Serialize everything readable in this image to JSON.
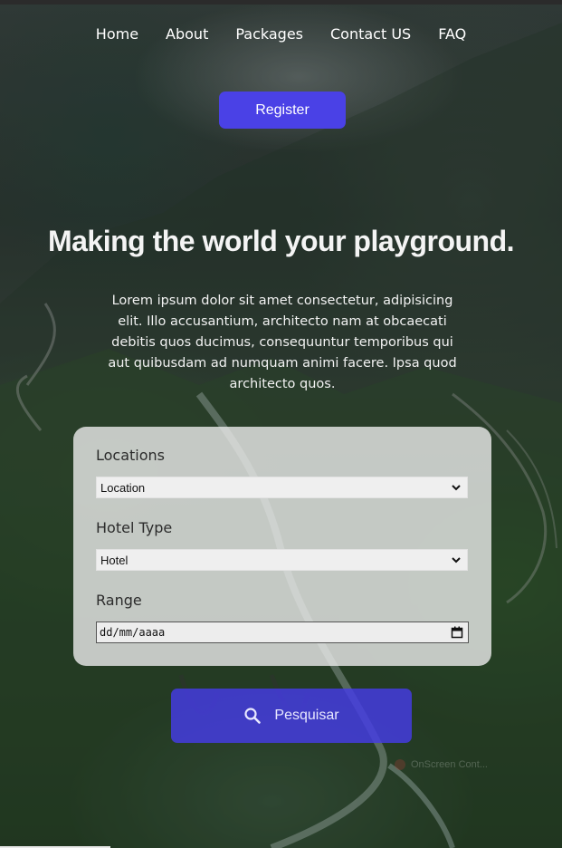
{
  "nav": {
    "items": [
      {
        "label": "Home"
      },
      {
        "label": "About"
      },
      {
        "label": "Packages"
      },
      {
        "label": "Contact US"
      },
      {
        "label": "FAQ"
      }
    ]
  },
  "hero": {
    "register_label": "Register",
    "title": "Making the world your playground.",
    "description": "Lorem ipsum dolor sit amet consectetur, adipisicing elit. Illo accusantium, architecto nam at obcaecati debitis quos ducimus, consequuntur temporibus qui aut quibusdam ad numquam animi facere. Ipsa quod architecto quos."
  },
  "search_form": {
    "locations_label": "Locations",
    "locations_value": "Location",
    "hotel_type_label": "Hotel Type",
    "hotel_type_value": "Hotel",
    "range_label": "Range",
    "range_placeholder": "dd/mm/aaaa",
    "submit_label": "Pesquisar"
  },
  "overlay_watermark": "OnScreen Cont...",
  "colors": {
    "accent": "#4a41e6",
    "card_bg": "#ececec"
  },
  "icons": [
    "search-icon",
    "chevron-down-icon",
    "calendar-icon"
  ]
}
